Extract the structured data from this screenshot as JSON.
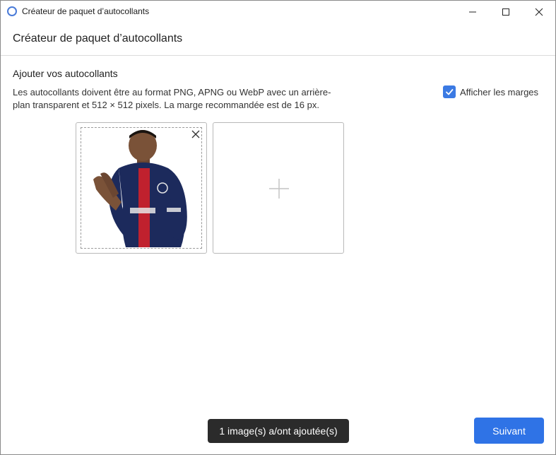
{
  "window": {
    "title": "Créateur de paquet d’autocollants",
    "icon": "app-ring-icon",
    "controls": [
      "minimize-icon",
      "maximize-icon",
      "close-icon"
    ]
  },
  "header": {
    "title": "Créateur de paquet d’autocollants"
  },
  "content": {
    "section_title": "Ajouter vos autocollants",
    "description": "Les autocollants doivent être au format PNG, APNG ou WebP avec un arrière-plan transparent et 512 × 512 pixels. La marge recommandée est de 16 px.",
    "show_margins": {
      "label": "Afficher les marges",
      "checked": true
    },
    "stickers": [
      {
        "type": "image",
        "icon": "remove-icon",
        "show_margin_guide": true
      },
      {
        "type": "add",
        "icon": "plus-icon"
      }
    ]
  },
  "toast": {
    "message": "1 image(s) a/ont ajoutée(s)"
  },
  "footer": {
    "next_label": "Suivant"
  },
  "colors": {
    "accent": "#2f73e6",
    "checkbox": "#3b7ae3",
    "toast_bg": "#2b2b2b"
  }
}
